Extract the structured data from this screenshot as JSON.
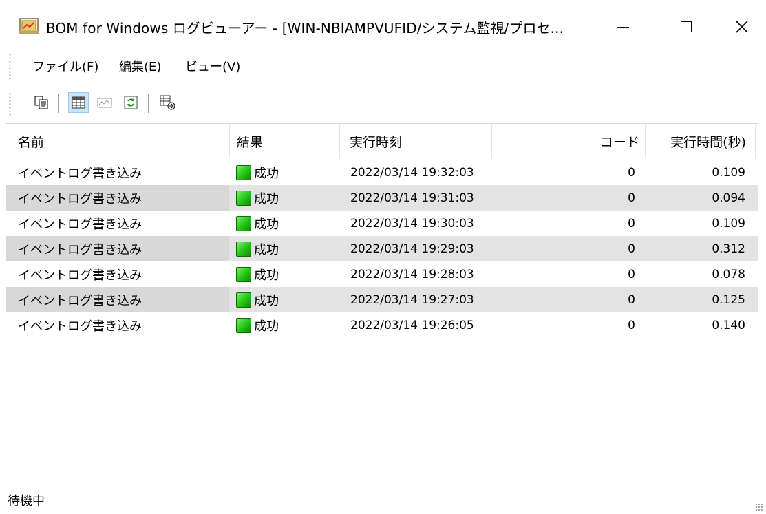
{
  "window": {
    "title": "BOM for Windows ログビューアー - [WIN-NBIAMPVUFID/システム監視/プロセ...",
    "controls": {
      "minimize": "—",
      "maximize": "☐",
      "close": "✕"
    }
  },
  "menu": [
    {
      "label": "ファイル(",
      "accel": "F",
      "suffix": ")"
    },
    {
      "label": "編集(",
      "accel": "E",
      "suffix": ")"
    },
    {
      "label": "ビュー(",
      "accel": "V",
      "suffix": ")"
    }
  ],
  "toolbar": {
    "buttons": [
      "copy-icon",
      "table-view-icon",
      "graph-view-icon",
      "refresh-icon",
      "export-icon"
    ],
    "active": "table-view-icon"
  },
  "list": {
    "columns": [
      "名前",
      "結果",
      "実行時刻",
      "コード",
      "実行時間(秒)"
    ],
    "rows": [
      {
        "name": "イベントログ書き込み",
        "result": "成功",
        "time": "2022/03/14 19:32:03",
        "code": "0",
        "duration": "0.109"
      },
      {
        "name": "イベントログ書き込み",
        "result": "成功",
        "time": "2022/03/14 19:31:03",
        "code": "0",
        "duration": "0.094"
      },
      {
        "name": "イベントログ書き込み",
        "result": "成功",
        "time": "2022/03/14 19:30:03",
        "code": "0",
        "duration": "0.109"
      },
      {
        "name": "イベントログ書き込み",
        "result": "成功",
        "time": "2022/03/14 19:29:03",
        "code": "0",
        "duration": "0.312"
      },
      {
        "name": "イベントログ書き込み",
        "result": "成功",
        "time": "2022/03/14 19:28:03",
        "code": "0",
        "duration": "0.078"
      },
      {
        "name": "イベントログ書き込み",
        "result": "成功",
        "time": "2022/03/14 19:27:03",
        "code": "0",
        "duration": "0.125"
      },
      {
        "name": "イベントログ書き込み",
        "result": "成功",
        "time": "2022/03/14 19:26:05",
        "code": "0",
        "duration": "0.140"
      }
    ]
  },
  "status": {
    "text": "待機中"
  },
  "colors": {
    "row_alt": "#e3e3e3",
    "success": "#22c412",
    "toolbar_active": "#cce4f7"
  }
}
